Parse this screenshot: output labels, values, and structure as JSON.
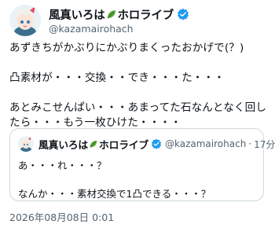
{
  "author": {
    "display_name": "風真いろは",
    "display_name_suffix": "ホロライブ",
    "handle": "@kazamairohach",
    "leaf_icon": "leaf-emoji",
    "verified_color": "#1d9bf0"
  },
  "post": {
    "text": "あずきちがかぶりにかぶりまくったおかげで(？)\n\n凸素材が・・・交換・・でき・・・た・・・\n\nあとみこせんぱい・・・あまってた石なんとなく回したら・・・もう一枚ひけた・・・・",
    "timestamp": "2026年08月08日 0:01"
  },
  "quote": {
    "display_name": "風真いろは",
    "display_name_suffix": "ホロライブ",
    "handle": "@kazamairohach",
    "separator": "·",
    "time_ago": "17分",
    "text": "あ・・・れ・・・？\n\nなんか・・・素材交換で1凸できる・・・？"
  },
  "colors": {
    "text_primary": "#0f1419",
    "text_secondary": "#536471",
    "border": "#cfd9de"
  }
}
